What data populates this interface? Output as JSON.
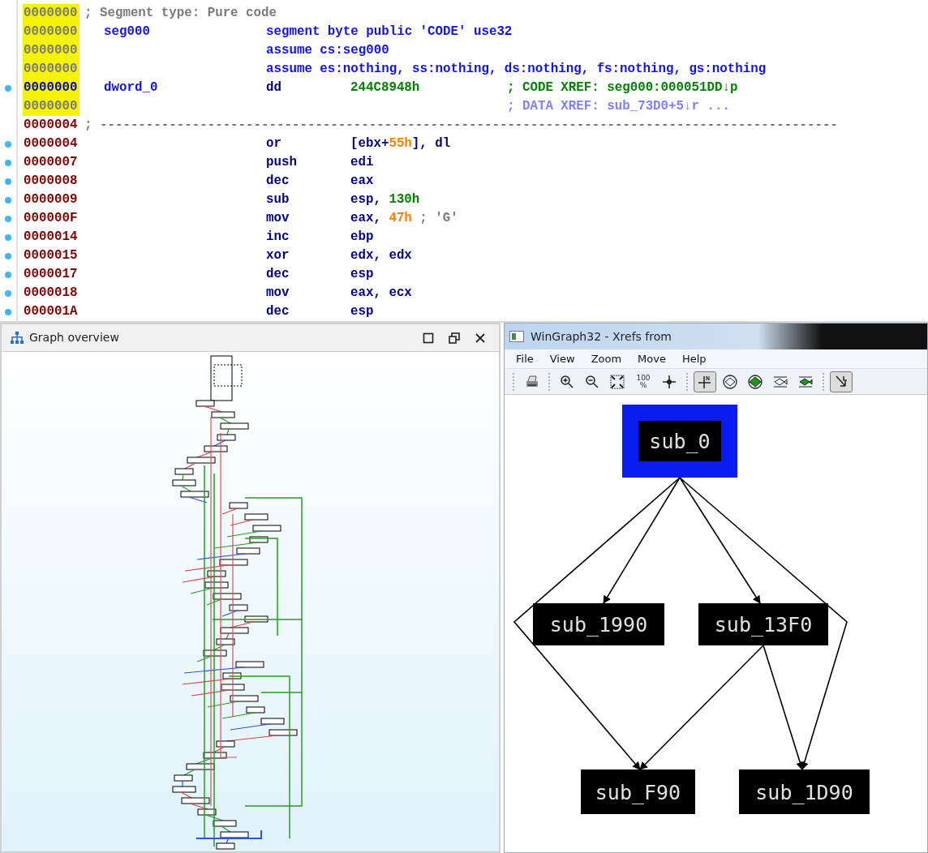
{
  "disassembly": {
    "lines": [
      {
        "address": "0000000",
        "highlighted": true,
        "current": false,
        "dot": false,
        "remark": {
          "text": "; Segment type: Pure code",
          "kind": "comment"
        }
      },
      {
        "address": "0000000",
        "highlighted": true,
        "current": false,
        "dot": false,
        "label": "seg000",
        "directive": "segment byte public 'CODE' use32"
      },
      {
        "address": "0000000",
        "highlighted": true,
        "current": false,
        "dot": false,
        "directive": "assume cs:seg000"
      },
      {
        "address": "0000000",
        "highlighted": true,
        "current": false,
        "dot": false,
        "directive": "assume es:nothing, ss:nothing, ds:nothing, fs:nothing, gs:nothing"
      },
      {
        "address": "0000000",
        "highlighted": true,
        "current": true,
        "dot": true,
        "label": "dword_0",
        "mnemonic": "dd",
        "operands": [
          {
            "text": "244C8948h",
            "kind": "imm"
          }
        ],
        "comment": {
          "text": "; CODE XREF: seg000:000051DD↓p",
          "kind": "code_xref"
        }
      },
      {
        "address": "0000000",
        "highlighted": true,
        "current": false,
        "dot": false,
        "comment": {
          "text": "; DATA XREF: sub_73D0+5↓r ...",
          "kind": "data_xref"
        }
      },
      {
        "address": "0000004",
        "highlighted": false,
        "current": false,
        "dot": false,
        "remark": {
          "text": "; ------------------------------------------------------------------------------------------------",
          "kind": "comment"
        }
      },
      {
        "address": "0000004",
        "highlighted": false,
        "current": false,
        "dot": true,
        "mnemonic": "or",
        "operands": [
          {
            "text": "[ebx+",
            "kind": "reg"
          },
          {
            "text": "55h",
            "kind": "num"
          },
          {
            "text": "], dl",
            "kind": "reg"
          }
        ]
      },
      {
        "address": "0000007",
        "highlighted": false,
        "current": false,
        "dot": true,
        "mnemonic": "push",
        "operands": [
          {
            "text": "edi",
            "kind": "reg"
          }
        ]
      },
      {
        "address": "0000008",
        "highlighted": false,
        "current": false,
        "dot": true,
        "mnemonic": "dec",
        "operands": [
          {
            "text": "eax",
            "kind": "reg"
          }
        ]
      },
      {
        "address": "0000009",
        "highlighted": false,
        "current": false,
        "dot": true,
        "mnemonic": "sub",
        "operands": [
          {
            "text": "esp, ",
            "kind": "reg"
          },
          {
            "text": "130h",
            "kind": "imm"
          }
        ]
      },
      {
        "address": "000000F",
        "highlighted": false,
        "current": false,
        "dot": true,
        "mnemonic": "mov",
        "operands": [
          {
            "text": "eax, ",
            "kind": "reg"
          },
          {
            "text": "47h",
            "kind": "num"
          },
          {
            "text": " ; 'G'",
            "kind": "comment"
          }
        ]
      },
      {
        "address": "0000014",
        "highlighted": false,
        "current": false,
        "dot": true,
        "mnemonic": "inc",
        "operands": [
          {
            "text": "ebp",
            "kind": "reg"
          }
        ]
      },
      {
        "address": "0000015",
        "highlighted": false,
        "current": false,
        "dot": true,
        "mnemonic": "xor",
        "operands": [
          {
            "text": "edx, edx",
            "kind": "reg"
          }
        ]
      },
      {
        "address": "0000017",
        "highlighted": false,
        "current": false,
        "dot": true,
        "mnemonic": "dec",
        "operands": [
          {
            "text": "esp",
            "kind": "reg"
          }
        ]
      },
      {
        "address": "0000018",
        "highlighted": false,
        "current": false,
        "dot": true,
        "mnemonic": "mov",
        "operands": [
          {
            "text": "eax, ecx",
            "kind": "reg"
          }
        ]
      },
      {
        "address": "000001A",
        "highlighted": false,
        "current": false,
        "dot": true,
        "mnemonic": "dec",
        "operands": [
          {
            "text": "esp",
            "kind": "reg"
          }
        ]
      }
    ]
  },
  "graph_overview": {
    "title": "Graph overview"
  },
  "wingraph": {
    "title": "WinGraph32 - Xrefs from",
    "menu": [
      "File",
      "View",
      "Zoom",
      "Move",
      "Help"
    ],
    "toolbar": [
      {
        "kind": "print",
        "pressed": false,
        "group_start": true
      },
      {
        "kind": "zoom_in",
        "pressed": false,
        "group_start": true
      },
      {
        "kind": "zoom_out",
        "pressed": false
      },
      {
        "kind": "fit",
        "pressed": false
      },
      {
        "kind": "percent",
        "text": "100 %",
        "pressed": false
      },
      {
        "kind": "move",
        "pressed": false
      },
      {
        "kind": "layout_normal",
        "pressed": true,
        "group_start": true
      },
      {
        "kind": "layout_circle",
        "pressed": false
      },
      {
        "kind": "layout_circle_green",
        "pressed": false
      },
      {
        "kind": "layout_fish",
        "pressed": false
      },
      {
        "kind": "layout_fish_green",
        "pressed": false
      },
      {
        "kind": "arrow_mode",
        "pressed": true,
        "group_start": true
      }
    ],
    "nodes": [
      {
        "label": "sub_0",
        "selected": true
      },
      {
        "label": "sub_1990",
        "selected": false
      },
      {
        "label": "sub_13F0",
        "selected": false
      },
      {
        "label": "sub_F90",
        "selected": false
      },
      {
        "label": "sub_1D90",
        "selected": false
      }
    ]
  }
}
